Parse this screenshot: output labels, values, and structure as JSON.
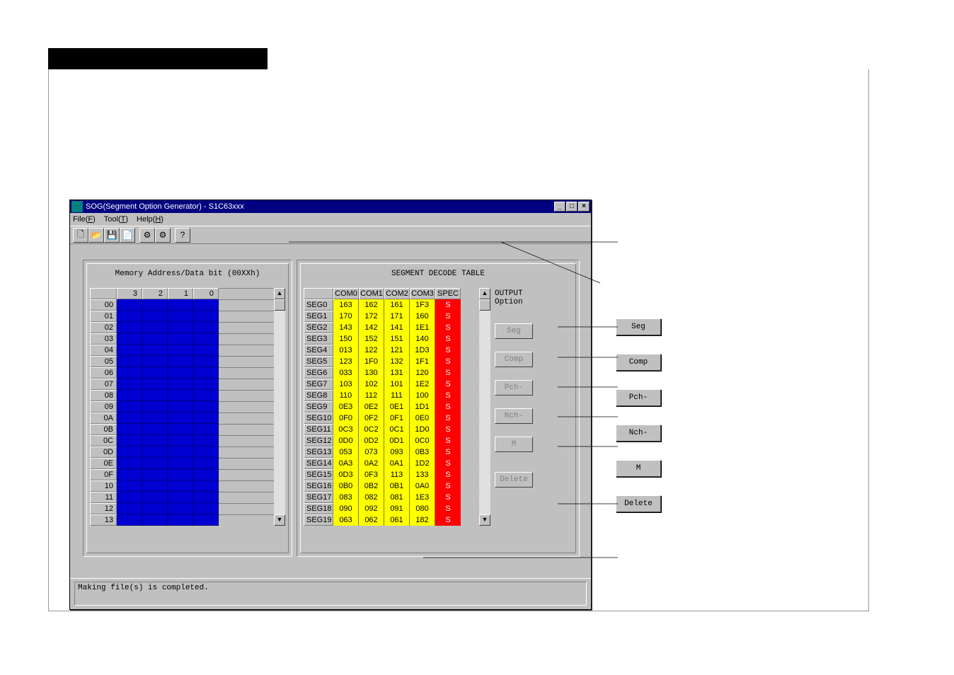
{
  "window": {
    "title": "SOG(Segment Option Generator) - S1C63xxx",
    "menu": {
      "file": "File(F)",
      "tool": "Tool(T)",
      "help": "Help(H)"
    }
  },
  "left_panel_title": "Memory Address/Data bit (00XXh)",
  "right_panel_title": "SEGMENT DECODE TABLE",
  "mem_cols": [
    "3",
    "2",
    "1",
    "0"
  ],
  "mem_rows": [
    "00",
    "01",
    "02",
    "03",
    "04",
    "05",
    "06",
    "07",
    "08",
    "09",
    "0A",
    "0B",
    "0C",
    "0D",
    "0E",
    "0F",
    "10",
    "11",
    "12",
    "13"
  ],
  "seg_cols": [
    "COM0",
    "COM1",
    "COM2",
    "COM3",
    "SPEC"
  ],
  "seg_rows": [
    {
      "label": "SEG0",
      "cells": [
        "163",
        "162",
        "161",
        "1F3"
      ],
      "spec": "S"
    },
    {
      "label": "SEG1",
      "cells": [
        "170",
        "172",
        "171",
        "160"
      ],
      "spec": "S"
    },
    {
      "label": "SEG2",
      "cells": [
        "143",
        "142",
        "141",
        "1E1"
      ],
      "spec": "S"
    },
    {
      "label": "SEG3",
      "cells": [
        "150",
        "152",
        "151",
        "140"
      ],
      "spec": "S"
    },
    {
      "label": "SEG4",
      "cells": [
        "013",
        "122",
        "121",
        "1D3"
      ],
      "spec": "S"
    },
    {
      "label": "SEG5",
      "cells": [
        "123",
        "1F0",
        "132",
        "1F1"
      ],
      "spec": "S"
    },
    {
      "label": "SEG6",
      "cells": [
        "033",
        "130",
        "131",
        "120"
      ],
      "spec": "S"
    },
    {
      "label": "SEG7",
      "cells": [
        "103",
        "102",
        "101",
        "1E2"
      ],
      "spec": "S"
    },
    {
      "label": "SEG8",
      "cells": [
        "110",
        "112",
        "111",
        "100"
      ],
      "spec": "S"
    },
    {
      "label": "SEG9",
      "cells": [
        "0E3",
        "0E2",
        "0E1",
        "1D1"
      ],
      "spec": "S"
    },
    {
      "label": "SEG10",
      "cells": [
        "0F0",
        "0F2",
        "0F1",
        "0E0"
      ],
      "spec": "S"
    },
    {
      "label": "SEG11",
      "cells": [
        "0C3",
        "0C2",
        "0C1",
        "1D0"
      ],
      "spec": "S"
    },
    {
      "label": "SEG12",
      "cells": [
        "0D0",
        "0D2",
        "0D1",
        "0C0"
      ],
      "spec": "S"
    },
    {
      "label": "SEG13",
      "cells": [
        "053",
        "073",
        "093",
        "0B3"
      ],
      "spec": "S"
    },
    {
      "label": "SEG14",
      "cells": [
        "0A3",
        "0A2",
        "0A1",
        "1D2"
      ],
      "spec": "S"
    },
    {
      "label": "SEG15",
      "cells": [
        "0D3",
        "0F3",
        "113",
        "133"
      ],
      "spec": "S"
    },
    {
      "label": "SEG16",
      "cells": [
        "0B0",
        "0B2",
        "0B1",
        "0A0"
      ],
      "spec": "S"
    },
    {
      "label": "SEG17",
      "cells": [
        "083",
        "082",
        "081",
        "1E3"
      ],
      "spec": "S"
    },
    {
      "label": "SEG18",
      "cells": [
        "090",
        "092",
        "091",
        "080"
      ],
      "spec": "S"
    },
    {
      "label": "SEG19",
      "cells": [
        "063",
        "062",
        "061",
        "182"
      ],
      "spec": "S"
    }
  ],
  "output": {
    "header1": "OUTPUT",
    "header2": "Option",
    "buttons": {
      "seg": "Seg",
      "comp": "Comp",
      "pch": "Pch-",
      "nch": "Nch-",
      "m": "M",
      "delete": "Delete"
    }
  },
  "callouts": {
    "seg": "Seg",
    "comp": "Comp",
    "pch": "Pch-",
    "nch": "Nch-",
    "m": "M",
    "delete": "Delete"
  },
  "status": "Making file(s) is completed."
}
